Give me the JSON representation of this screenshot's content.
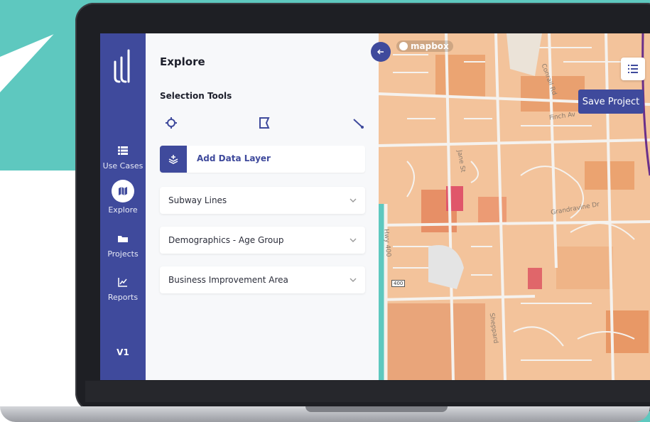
{
  "sidebar": {
    "items": [
      {
        "label": "Use Cases",
        "icon": "list-icon"
      },
      {
        "label": "Explore",
        "icon": "map-icon",
        "active": true
      },
      {
        "label": "Projects",
        "icon": "folder-icon"
      },
      {
        "label": "Reports",
        "icon": "chart-icon"
      }
    ],
    "version": "V1"
  },
  "panel": {
    "title": "Explore",
    "selection_tools": {
      "title": "Selection Tools",
      "tools": [
        {
          "icon": "point-select-icon"
        },
        {
          "icon": "polygon-select-icon"
        },
        {
          "icon": "line-select-icon"
        }
      ]
    },
    "add_data_layer": {
      "label": "Add Data Layer",
      "icon": "layers-add-icon"
    },
    "accordions": [
      {
        "label": "Subway Lines"
      },
      {
        "label": "Demographics - Age Group"
      },
      {
        "label": "Business Improvement Area"
      }
    ]
  },
  "map": {
    "attribution": "mapbox",
    "save_label": "Save Project",
    "labels": {
      "finch": "Finch Av",
      "conrail": "Conrail Rd",
      "grandravine": "Grandravine Dr",
      "jane": "Jane St",
      "hwy400": "Hwy 400",
      "shield": "400",
      "sheppard": "Sheppard"
    }
  },
  "colors": {
    "brand": "#3f4a9c",
    "teal": "#5ec8bf",
    "map_fill_light": "#f5c9a4",
    "map_fill_mid": "#eca477",
    "map_fill_dark": "#e07a5f",
    "map_fill_highlight": "#e0566a"
  }
}
